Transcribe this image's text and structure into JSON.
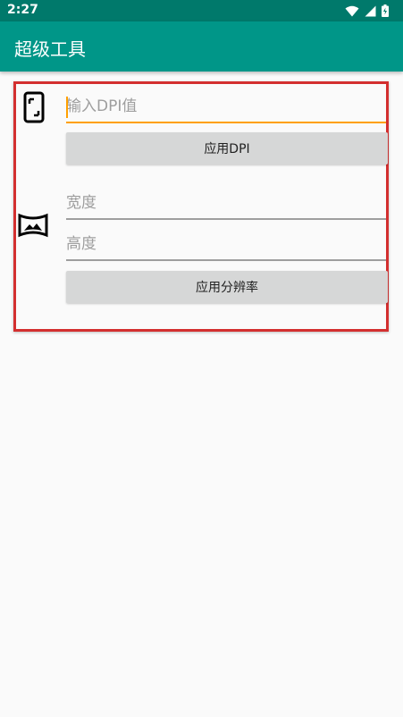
{
  "status_bar": {
    "time": "2:27"
  },
  "app_bar": {
    "title": "超级工具"
  },
  "dpi_section": {
    "input": {
      "placeholder": "输入DPI值",
      "value": ""
    },
    "apply_button": "应用DPI"
  },
  "resolution_section": {
    "width_input": {
      "placeholder": "宽度",
      "value": ""
    },
    "height_input": {
      "placeholder": "高度",
      "value": ""
    },
    "apply_button": "应用分辨率"
  },
  "colors": {
    "status_bar": "#00796b",
    "app_bar": "#009688",
    "accent": "#ffa000",
    "highlight_border": "#d32f2f"
  },
  "icons": {
    "status": [
      "wifi-icon",
      "cellular-signal-icon",
      "battery-icon"
    ],
    "dpi": "phone-screen-icon",
    "resolution": "panorama-icon"
  }
}
